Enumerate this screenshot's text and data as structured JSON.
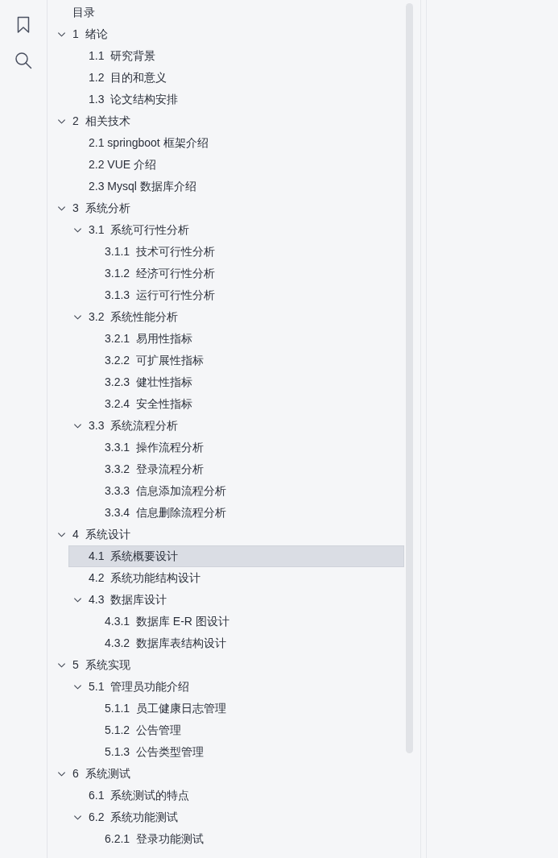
{
  "outline": {
    "title": "目录",
    "items": [
      {
        "label": "1  绪论",
        "expanded": true,
        "selected": false,
        "children": [
          {
            "label": "1.1  研究背景",
            "selected": false
          },
          {
            "label": "1.2  目的和意义",
            "selected": false
          },
          {
            "label": "1.3  论文结构安排",
            "selected": false
          }
        ]
      },
      {
        "label": "2  相关技术",
        "expanded": true,
        "selected": false,
        "children": [
          {
            "label": "2.1 springboot 框架介绍",
            "selected": false
          },
          {
            "label": "2.2 VUE 介绍",
            "selected": false
          },
          {
            "label": "2.3 Mysql 数据库介绍",
            "selected": false
          }
        ]
      },
      {
        "label": "3  系统分析",
        "expanded": true,
        "selected": false,
        "children": [
          {
            "label": "3.1  系统可行性分析",
            "expanded": true,
            "selected": false,
            "children": [
              {
                "label": "3.1.1  技术可行性分析",
                "selected": false
              },
              {
                "label": "3.1.2  经济可行性分析",
                "selected": false
              },
              {
                "label": "3.1.3  运行可行性分析",
                "selected": false
              }
            ]
          },
          {
            "label": "3.2  系统性能分析",
            "expanded": true,
            "selected": false,
            "children": [
              {
                "label": "3.2.1  易用性指标",
                "selected": false
              },
              {
                "label": "3.2.2  可扩展性指标",
                "selected": false
              },
              {
                "label": "3.2.3  健壮性指标",
                "selected": false
              },
              {
                "label": "3.2.4  安全性指标",
                "selected": false
              }
            ]
          },
          {
            "label": "3.3  系统流程分析",
            "expanded": true,
            "selected": false,
            "children": [
              {
                "label": "3.3.1  操作流程分析",
                "selected": false
              },
              {
                "label": "3.3.2  登录流程分析",
                "selected": false
              },
              {
                "label": "3.3.3  信息添加流程分析",
                "selected": false
              },
              {
                "label": "3.3.4  信息删除流程分析",
                "selected": false
              }
            ]
          }
        ]
      },
      {
        "label": "4  系统设计",
        "expanded": true,
        "selected": false,
        "children": [
          {
            "label": "4.1  系统概要设计",
            "selected": true
          },
          {
            "label": "4.2  系统功能结构设计",
            "selected": false
          },
          {
            "label": "4.3  数据库设计",
            "expanded": true,
            "selected": false,
            "children": [
              {
                "label": "4.3.1  数据库 E-R 图设计",
                "selected": false
              },
              {
                "label": "4.3.2  数据库表结构设计",
                "selected": false
              }
            ]
          }
        ]
      },
      {
        "label": "5  系统实现",
        "expanded": true,
        "selected": false,
        "children": [
          {
            "label": "5.1  管理员功能介绍",
            "expanded": true,
            "selected": false,
            "children": [
              {
                "label": "5.1.1  员工健康日志管理",
                "selected": false
              },
              {
                "label": "5.1.2  公告管理",
                "selected": false
              },
              {
                "label": "5.1.3  公告类型管理",
                "selected": false
              }
            ]
          }
        ]
      },
      {
        "label": "6  系统测试",
        "expanded": true,
        "selected": false,
        "children": [
          {
            "label": "6.1  系统测试的特点",
            "selected": false
          },
          {
            "label": "6.2  系统功能测试",
            "expanded": true,
            "selected": false,
            "children": [
              {
                "label": "6.2.1  登录功能测试",
                "selected": false
              }
            ]
          }
        ]
      }
    ]
  }
}
